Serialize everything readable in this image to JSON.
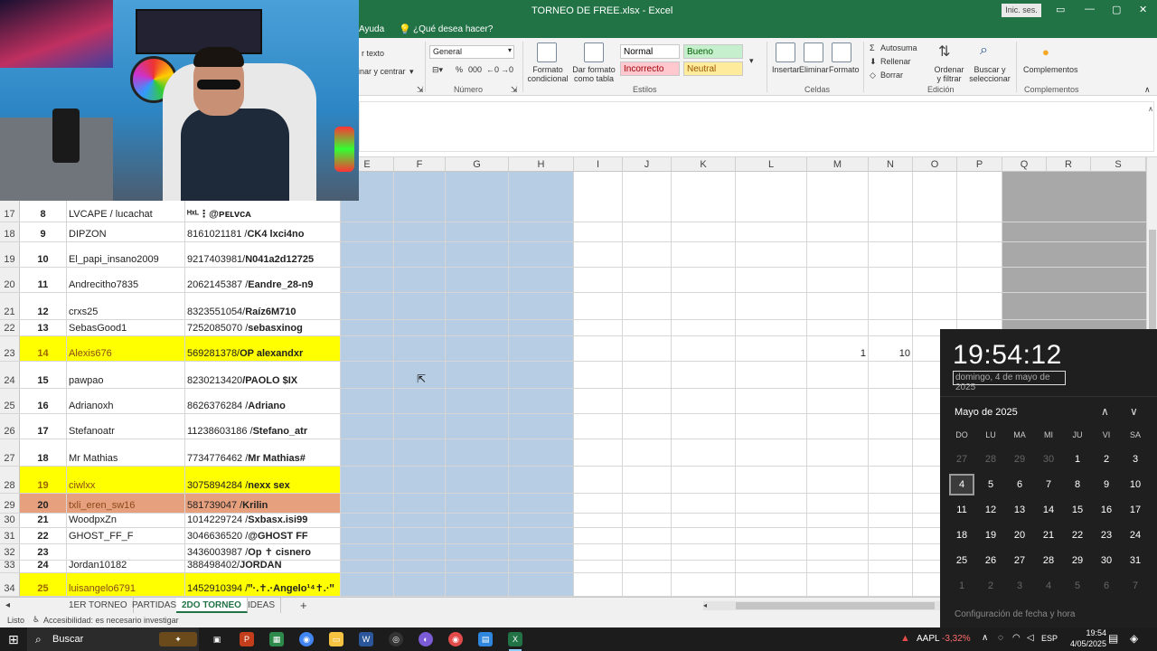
{
  "window": {
    "title": "TORNEO DE FREE.xlsx  -  Excel",
    "signin": "Inic. ses.",
    "min": "—",
    "restore": "▢",
    "close": "✕"
  },
  "tellbar": {
    "help": "Ayuda",
    "tellme": "¿Qué desea hacer?"
  },
  "ribbon": {
    "wrap_text": "r texto",
    "merge_center": "inar y centrar",
    "number_format": "General",
    "number_group": "Número",
    "conditional_format": "Formato condicional",
    "format_table": "Dar formato como tabla",
    "styles": {
      "normal": "Normal",
      "bueno": "Bueno",
      "incorrecto": "Incorrecto",
      "neutral": "Neutral"
    },
    "styles_group": "Estilos",
    "insert": "Insertar",
    "delete": "Eliminar",
    "format": "Formato",
    "cells_group": "Celdas",
    "autosum": "Autosuma",
    "fill": "Rellenar",
    "clear": "Borrar",
    "sort_filter": "Ordenar y filtrar",
    "find_select": "Buscar y seleccionar",
    "edit_group": "Edición",
    "addins": "Complementos",
    "addins_group": "Complementos",
    "percent": "%",
    "thousands": "000"
  },
  "columns": [
    "E",
    "F",
    "G",
    "H",
    "I",
    "J",
    "K",
    "L",
    "M",
    "N",
    "O",
    "P",
    "Q",
    "R",
    "S"
  ],
  "rows": [
    {
      "row": "17",
      "num": "8",
      "name": "LVCAPE / lucachat",
      "id": "",
      "id_bold": "ᴴˣᴸ⋮@ᴘᴇʟᴠᴄᴀ",
      "fill": ""
    },
    {
      "row": "18",
      "num": "9",
      "name": "DIPZON",
      "id": "8161021181 / ",
      "id_bold": "CK4 lxci4no",
      "fill": ""
    },
    {
      "row": "19",
      "num": "10",
      "name": "El_papi_insano2009",
      "id": "9217403981/ ",
      "id_bold": "N041a2d12725",
      "fill": ""
    },
    {
      "row": "20",
      "num": "11",
      "name": "Andrecitho7835",
      "id": "2062145387 / ",
      "id_bold": "Eandre_28-n9",
      "fill": ""
    },
    {
      "row": "21",
      "num": "12",
      "name": "crxs25",
      "id": "8323551054/ ",
      "id_bold": "Raíz6M710",
      "fill": ""
    },
    {
      "row": "22",
      "num": "13",
      "name": "SebasGood1",
      "id": "7252085070 / ",
      "id_bold": "sebasxinog",
      "fill": ""
    },
    {
      "row": "23",
      "num": "14",
      "name": "Alexis676",
      "id": "569281378/ ",
      "id_bold": "OP alexandxr",
      "fill": "yellow"
    },
    {
      "row": "24",
      "num": "15",
      "name": "pawpao",
      "id": "8230213420 ",
      "id_bold": "/PAOLO $IX",
      "fill": ""
    },
    {
      "row": "25",
      "num": "16",
      "name": "Adrianoxh",
      "id": "8626376284 / ",
      "id_bold": "Adriano",
      "fill": ""
    },
    {
      "row": "26",
      "num": "17",
      "name": "Stefanoatr",
      "id": "11238603186 / ",
      "id_bold": "Stefano_atr",
      "fill": ""
    },
    {
      "row": "27",
      "num": "18",
      "name": "Mr Mathias",
      "id": "7734776462 / ",
      "id_bold": "Mr Mathias#",
      "fill": ""
    },
    {
      "row": "28",
      "num": "19",
      "name": "ciwlxx",
      "id": "3075894284 / ",
      "id_bold": "nexx sex",
      "fill": "yellow"
    },
    {
      "row": "29",
      "num": "20",
      "name": "txli_eren_sw16",
      "id": "581739047 / ",
      "id_bold": "Krilin",
      "fill": "salmon"
    },
    {
      "row": "30",
      "num": "21",
      "name": "WoodpxZn",
      "id": "1014229724 / ",
      "id_bold": "Sxbasx.isi99",
      "fill": ""
    },
    {
      "row": "31",
      "num": "22",
      "name": "GHOST_FF_F",
      "id": "3046636520 / ",
      "id_bold": "@GHOST FF",
      "fill": ""
    },
    {
      "row": "32",
      "num": "23",
      "name": "",
      "id": "3436003987 / ",
      "id_bold": "Op   ✝   cisnero",
      "fill": ""
    },
    {
      "row": "33",
      "num": "24",
      "name": "Jordan10182",
      "id": "388498402/ ",
      "id_bold": "JORDAN",
      "fill": ""
    },
    {
      "row": "34",
      "num": "25",
      "name": "luisangelo6791",
      "id": "1452910394 / ",
      "id_bold": "ꞌꞌ·.✝.·Angelo¹⁴✝.·ꞌꞌ",
      "fill": "yellow"
    }
  ],
  "row23_values": {
    "m": "1",
    "n": "10"
  },
  "sheets": [
    "1ER TORNEO",
    "PARTIDAS",
    "2DO TORNEO",
    "IDEAS"
  ],
  "active_sheet": "2DO TORNEO",
  "add_sheet": "+",
  "status": {
    "ready": "Listo",
    "accessibility": "Accesibilidad: es necesario investigar"
  },
  "taskbar": {
    "search": "Buscar",
    "stock_name": "AAPL",
    "stock_change": "-3,32%",
    "lang": "ESP",
    "time": "19:54",
    "date": "4/05/2025"
  },
  "calendar": {
    "time": "19:54:12",
    "date_long": "domingo, 4 de mayo de 2025",
    "month": "Mayo de 2025",
    "weekdays": [
      "DO",
      "LU",
      "MA",
      "MI",
      "JU",
      "VI",
      "SA"
    ],
    "weeks": [
      [
        "27",
        "28",
        "29",
        "30",
        "1",
        "2",
        "3"
      ],
      [
        "4",
        "5",
        "6",
        "7",
        "8",
        "9",
        "10"
      ],
      [
        "11",
        "12",
        "13",
        "14",
        "15",
        "16",
        "17"
      ],
      [
        "18",
        "19",
        "20",
        "21",
        "22",
        "23",
        "24"
      ],
      [
        "25",
        "26",
        "27",
        "28",
        "29",
        "30",
        "31"
      ],
      [
        "1",
        "2",
        "3",
        "4",
        "5",
        "6",
        "7"
      ]
    ],
    "today": "4",
    "footer": "Configuración de fecha y hora"
  },
  "colors": {
    "excel_green": "#217346",
    "selection_blue": "#b7cde3",
    "highlight_yellow": "#ffff00",
    "highlight_salmon": "#e6a07e"
  }
}
